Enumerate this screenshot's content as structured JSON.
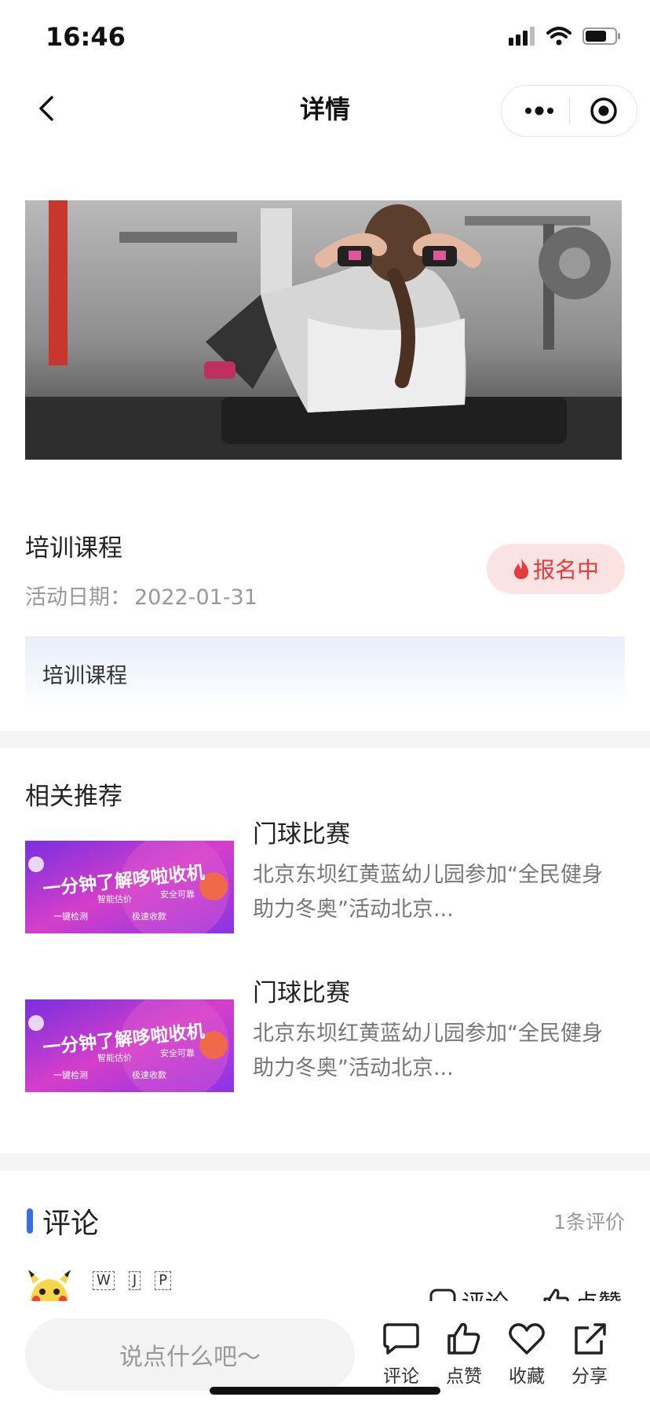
{
  "status_bar": {
    "time": "16:46"
  },
  "nav": {
    "title": "详情"
  },
  "activity": {
    "title": "培训课程",
    "date_label": "活动日期：",
    "date": "2022-01-31",
    "status_badge": "报名中",
    "description": "培训课程"
  },
  "recommend": {
    "section_title": "相关推荐",
    "items": [
      {
        "title": "门球比赛",
        "desc": "北京东坝红黄蓝幼儿园参加“全民健身 助力冬奥”活动北京...",
        "thumb": {
          "headline": "一分钟了解哆啦收机",
          "tags": [
            "智能估价",
            "安全可靠",
            "一键检测",
            "极速收款"
          ]
        }
      },
      {
        "title": "门球比赛",
        "desc": "北京东坝红黄蓝幼儿园参加“全民健身 助力冬奥”活动北京...",
        "thumb": {
          "headline": "一分钟了解哆啦收机",
          "tags": [
            "智能估价",
            "安全可靠",
            "一键检测",
            "极速收款"
          ]
        }
      }
    ]
  },
  "comments": {
    "title": "评论",
    "count_text": "1条评价",
    "first": {
      "name_glyphs": [
        "W",
        "J",
        "P"
      ],
      "comment_label": "评论",
      "like_label": "点赞"
    }
  },
  "bottom_bar": {
    "placeholder": "说点什么吧～",
    "actions": [
      {
        "label": "评论",
        "icon": "comment-icon"
      },
      {
        "label": "点赞",
        "icon": "thumbs-up-icon"
      },
      {
        "label": "收藏",
        "icon": "heart-icon"
      },
      {
        "label": "分享",
        "icon": "share-icon"
      }
    ]
  },
  "colors": {
    "accent_blue": "#3b6fe0",
    "badge_red": "#e53b3b",
    "badge_bg": "#fbe3e3"
  }
}
